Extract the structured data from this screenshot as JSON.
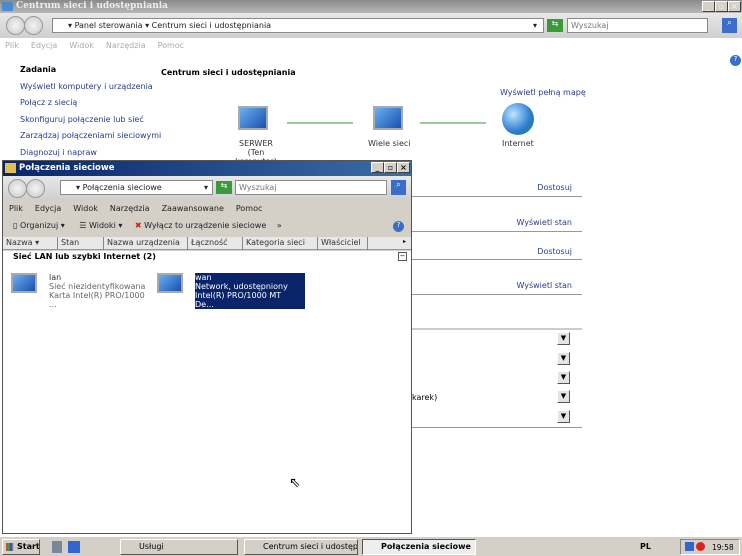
{
  "outer": {
    "title": "Centrum sieci i udostępniania",
    "breadcrumb": [
      "Panel sterowania",
      "Centrum sieci i udostępniania"
    ],
    "search_placeholder": "Wyszukaj",
    "menu": [
      "Plik",
      "Edycja",
      "Widok",
      "Narzędzia",
      "Pomoc"
    ],
    "tasks_heading": "Zadania",
    "tasks": [
      "Wyświetl komputery i urządzenia",
      "Połącz z siecią",
      "Skonfiguruj połączenie lub sieć",
      "Zarządzaj połączeniami sieciowymi",
      "Diagnozuj i napraw"
    ],
    "heading": "Centrum sieci i udostępniania",
    "full_map": "Wyświetl pełną mapę",
    "map": {
      "computer": "SERWER",
      "computer_sub": "(Ten komputer)",
      "networks": "Wiele sieci",
      "internet": "Internet"
    },
    "links": [
      "Dostosuj",
      "Wyświetl stan",
      "Dostosuj",
      "Wyświetl stan"
    ],
    "partial_text": "karek)"
  },
  "inner": {
    "title": "Połączenia sieciowe",
    "breadcrumb": "Połączenia sieciowe",
    "search_placeholder": "Wyszukaj",
    "menu": [
      "Plik",
      "Edycja",
      "Widok",
      "Narzędzia",
      "Zaawansowane",
      "Pomoc"
    ],
    "toolbar": {
      "organize": "Organizuj",
      "views": "Widoki",
      "disable": "Wyłącz to urządzenie sieciowe",
      "more": "»"
    },
    "columns": [
      "Nazwa",
      "Stan",
      "Nazwa urządzenia",
      "Łączność",
      "Kategoria sieci",
      "Właściciel"
    ],
    "group": "Sieć LAN lub szybki Internet (2)",
    "items": [
      {
        "name": "lan",
        "status": "Sieć niezidentyfikowana",
        "device": "Karta Intel(R) PRO/1000 ..."
      },
      {
        "name": "wan",
        "status": "Network, udostępniony",
        "device": "Intel(R) PRO/1000 MT De..."
      }
    ]
  },
  "taskbar": {
    "start": "Start",
    "buttons": [
      "Usługi",
      "Centrum sieci i udostępni...",
      "Połączenia sieciowe"
    ],
    "lang": "PL",
    "clock": "19:58"
  }
}
